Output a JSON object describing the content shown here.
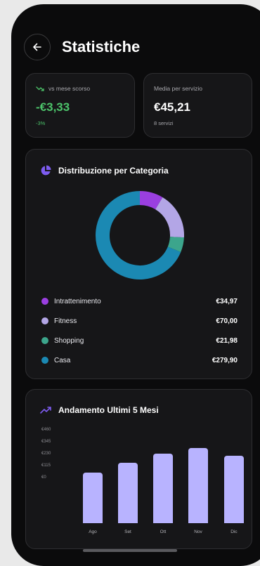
{
  "header": {
    "title": "Statistiche",
    "back_icon": "arrow-left-icon"
  },
  "stats": [
    {
      "label": "vs mese scorso",
      "value": "-€3,33",
      "sub": "-3%",
      "value_color": "#4cc36a",
      "sub_color": "#4cc36a",
      "icon": "trending-down-icon"
    },
    {
      "label": "Media per servizio",
      "value": "€45,21",
      "sub": "8 servizi",
      "value_color": "#ffffff",
      "sub_color": "#a8a8ad"
    }
  ],
  "distribution": {
    "title": "Distribuzione per Categoria",
    "icon": "pie-chart-icon",
    "items": [
      {
        "name": "Intrattenimento",
        "value": "€34,97",
        "amount": 34.97,
        "color": "#9a3fe0"
      },
      {
        "name": "Fitness",
        "value": "€70,00",
        "amount": 70.0,
        "color": "#b3a6e6"
      },
      {
        "name": "Shopping",
        "value": "€21,98",
        "amount": 21.98,
        "color": "#3ca58c"
      },
      {
        "name": "Casa",
        "value": "€279,90",
        "amount": 279.9,
        "color": "#1b89b3"
      }
    ]
  },
  "trend": {
    "title": "Andamento Ultimi 5 Mesi",
    "icon": "trending-up-icon",
    "chart_data": {
      "type": "bar",
      "categories": [
        "Ago",
        "Set",
        "Ott",
        "Nov",
        "Dic"
      ],
      "values": [
        290,
        345,
        395,
        430,
        383
      ],
      "ytick_labels": [
        "€460",
        "€345",
        "€230",
        "€115",
        "€0"
      ],
      "ylim": [
        0,
        520
      ],
      "color": "#b8b3ff"
    }
  }
}
